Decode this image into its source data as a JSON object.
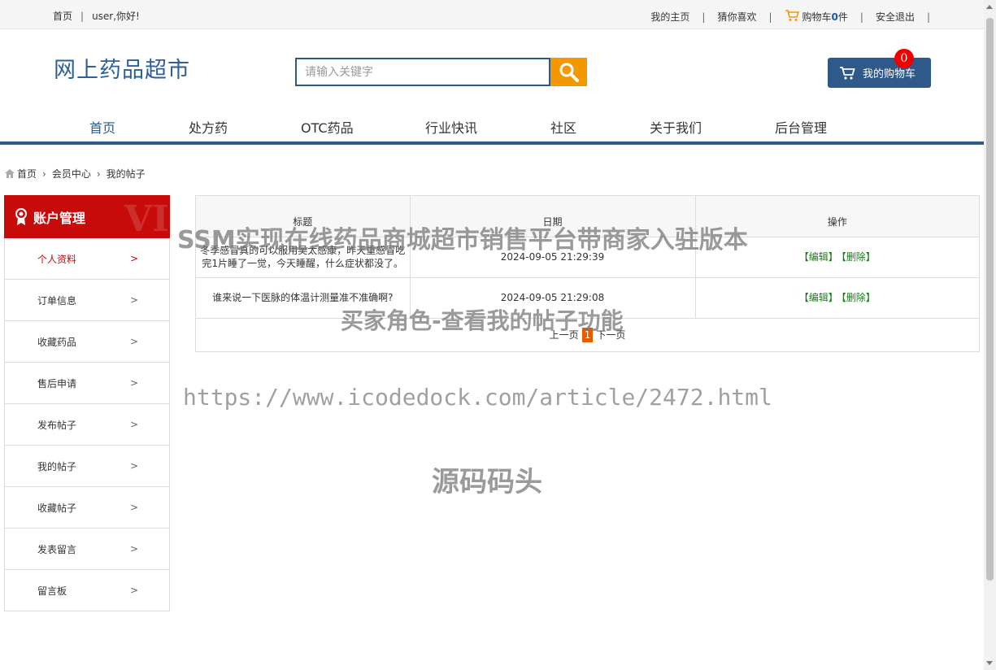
{
  "topbar": {
    "home": "首页",
    "greeting": "user,你好!",
    "my_home": "我的主页",
    "guess": "猜你喜欢",
    "cart_prefix": "购物车",
    "cart_count": "0",
    "cart_suffix": "件",
    "logout": "安全退出"
  },
  "header": {
    "logo": "网上药品超市",
    "search_placeholder": "请输入关键字",
    "my_cart": "我的购物车",
    "cart_badge": "0"
  },
  "nav": [
    "首页",
    "处方药",
    "OTC药品",
    "行业快讯",
    "社区",
    "关于我们",
    "后台管理"
  ],
  "breadcrumb": [
    "首页",
    "会员中心",
    "我的帖子"
  ],
  "sidebar": {
    "title": "账户管理",
    "vip": "VIP",
    "items": [
      "个人资料",
      "订单信息",
      "收藏药品",
      "售后申请",
      "发布帖子",
      "我的帖子",
      "收藏帖子",
      "发表留言",
      "留言板"
    ]
  },
  "table": {
    "headers": [
      "标题",
      "日期",
      "操作"
    ],
    "rows": [
      {
        "title": "冬季感冒真的可以服用吴太感康，昨天重感冒吃完1片睡了一觉，今天睡醒，什么症状都没了。",
        "date": "2024-09-05 21:29:39",
        "edit": "【编辑】",
        "delete": "【删除】"
      },
      {
        "title": "谁来说一下医脉的体温计测量准不准确啊?",
        "date": "2024-09-05 21:29:08",
        "edit": "【编辑】",
        "delete": "【删除】"
      }
    ],
    "pager": {
      "prev": "上一页",
      "current": "1",
      "next": "下一页"
    }
  },
  "watermarks": [
    "SSM实现在线药品商城超市销售平台带商家入驻版本",
    "买家角色-查看我的帖子功能",
    "https://www.icodedock.com/article/2472.html",
    "源码码头"
  ]
}
